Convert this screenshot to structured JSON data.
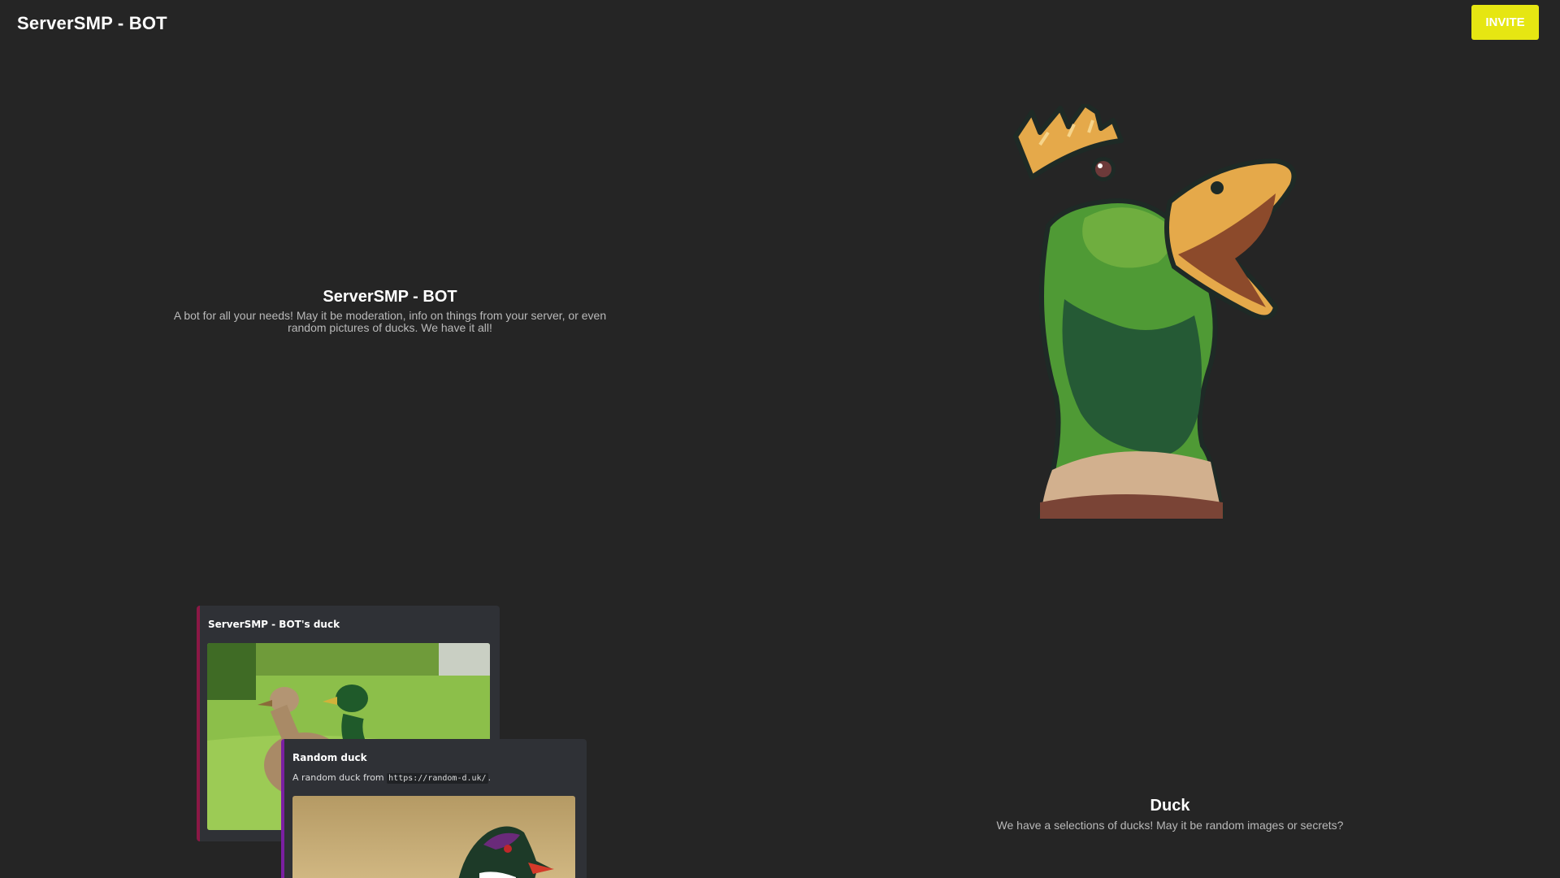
{
  "header": {
    "brand": "ServerSMP - BOT",
    "invite_label": "INVITE",
    "invite_color": "#e6e612"
  },
  "hero": {
    "title": "ServerSMP - BOT",
    "description": "A bot for all your needs! May it be moderation, info on things from your server, or even random pictures of ducks. We have it all!",
    "image_icon": "crowned-duck-mascot"
  },
  "embeds": [
    {
      "title": "ServerSMP - BOT's duck",
      "accent": "#8b1845",
      "image_icon": "mallard-ducks-photo"
    },
    {
      "title": "Random duck",
      "desc_prefix": "A random duck from ",
      "desc_code": "https://random-d.uk/",
      "desc_suffix": ".",
      "accent": "#7b1fa2",
      "image_icon": "wood-duck-photo"
    }
  ],
  "duck_section": {
    "title": "Duck",
    "description": "We have a selections of ducks! May it be random images or secrets?"
  },
  "colors": {
    "background": "#252525",
    "embed_background": "#2f3136"
  }
}
